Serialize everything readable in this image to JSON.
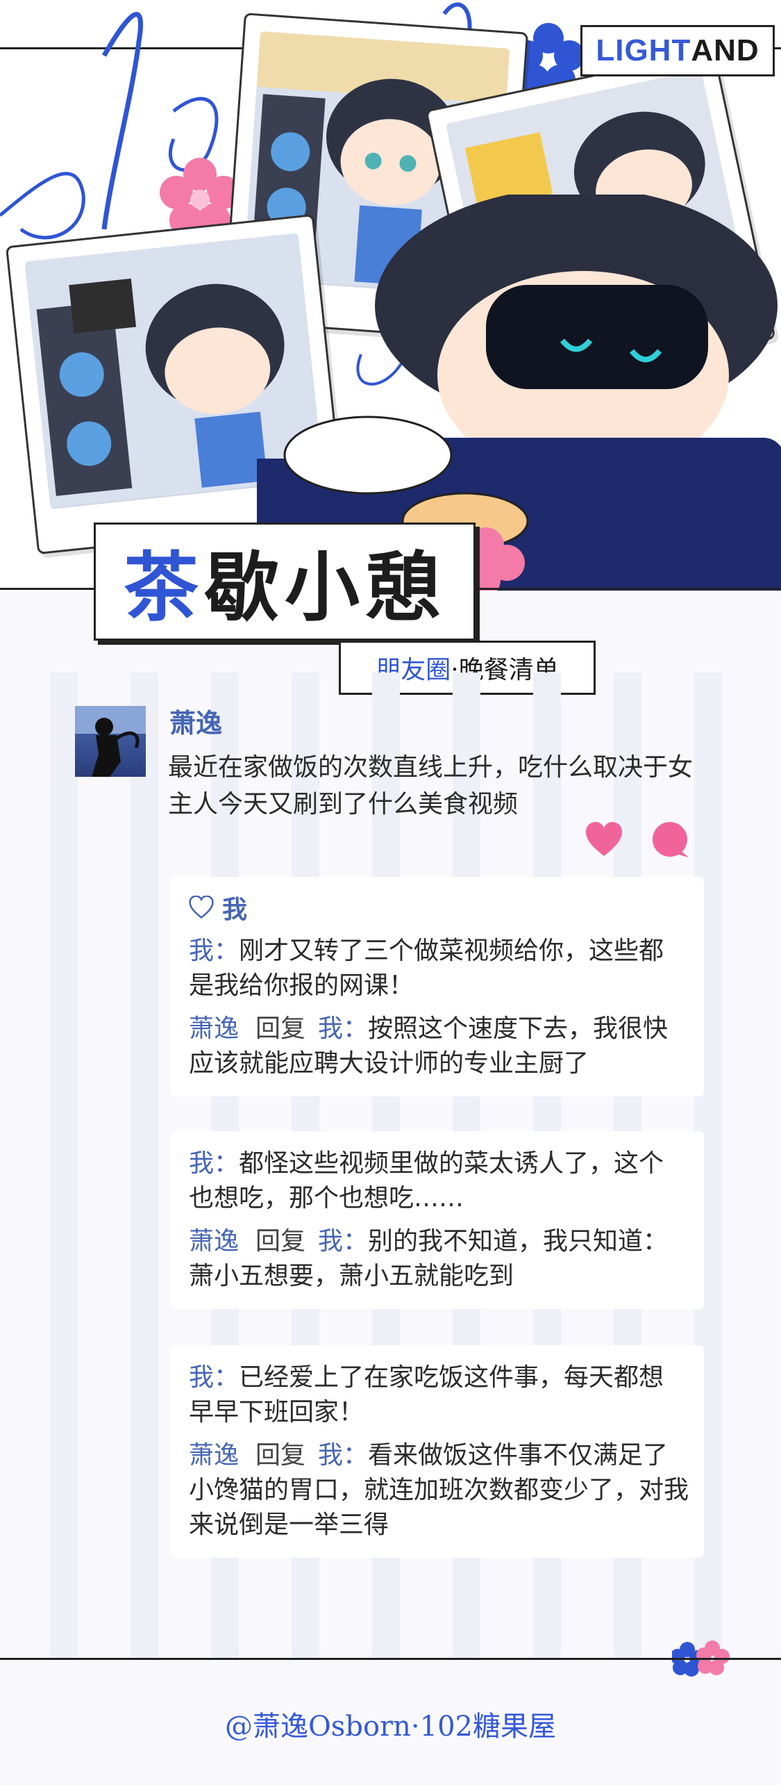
{
  "brand": {
    "part1": "LIGHT",
    "part2": "AND"
  },
  "title": {
    "c1": "茶",
    "c2": "歇",
    "c3": "小",
    "c4": "憩"
  },
  "subtitle": {
    "blue": "朋友圈",
    "rest": "·晚餐清单"
  },
  "post": {
    "author": "萧逸",
    "text": "最近在家做饭的次数直线上升，吃什么取决于女主人今天又刷到了什么美食视频"
  },
  "likes": {
    "icon": "heart-outline-icon",
    "name": "我"
  },
  "threads": [
    {
      "first": {
        "name": "我：",
        "text": "刚才又转了三个做菜视频给你，这些都是我给你报的网课！"
      },
      "reply": {
        "from": "萧逸",
        "verb": "回复",
        "to": "我：",
        "text": "按照这个速度下去，我很快应该就能应聘大设计师的专业主厨了"
      }
    },
    {
      "first": {
        "name": "我：",
        "text": "都怪这些视频里做的菜太诱人了，这个也想吃，那个也想吃……"
      },
      "reply": {
        "from": "萧逸",
        "verb": "回复",
        "to": "我：",
        "text": "别的我不知道，我只知道：萧小五想要，萧小五就能吃到"
      }
    },
    {
      "first": {
        "name": "我：",
        "text": "已经爱上了在家吃饭这件事，每天都想早早下班回家！"
      },
      "reply": {
        "from": "萧逸",
        "verb": "回复",
        "to": "我：",
        "text": "看来做饭这件事不仅满足了小馋猫的胃口，就连加班次数都变少了，对我来说倒是一举三得"
      }
    }
  ],
  "footer": "@萧逸Osborn·102糖果屋",
  "colors": {
    "accent": "#3559d6",
    "name": "#4565b5",
    "pink": "#f0649a",
    "bg": "#f9f9fd"
  }
}
